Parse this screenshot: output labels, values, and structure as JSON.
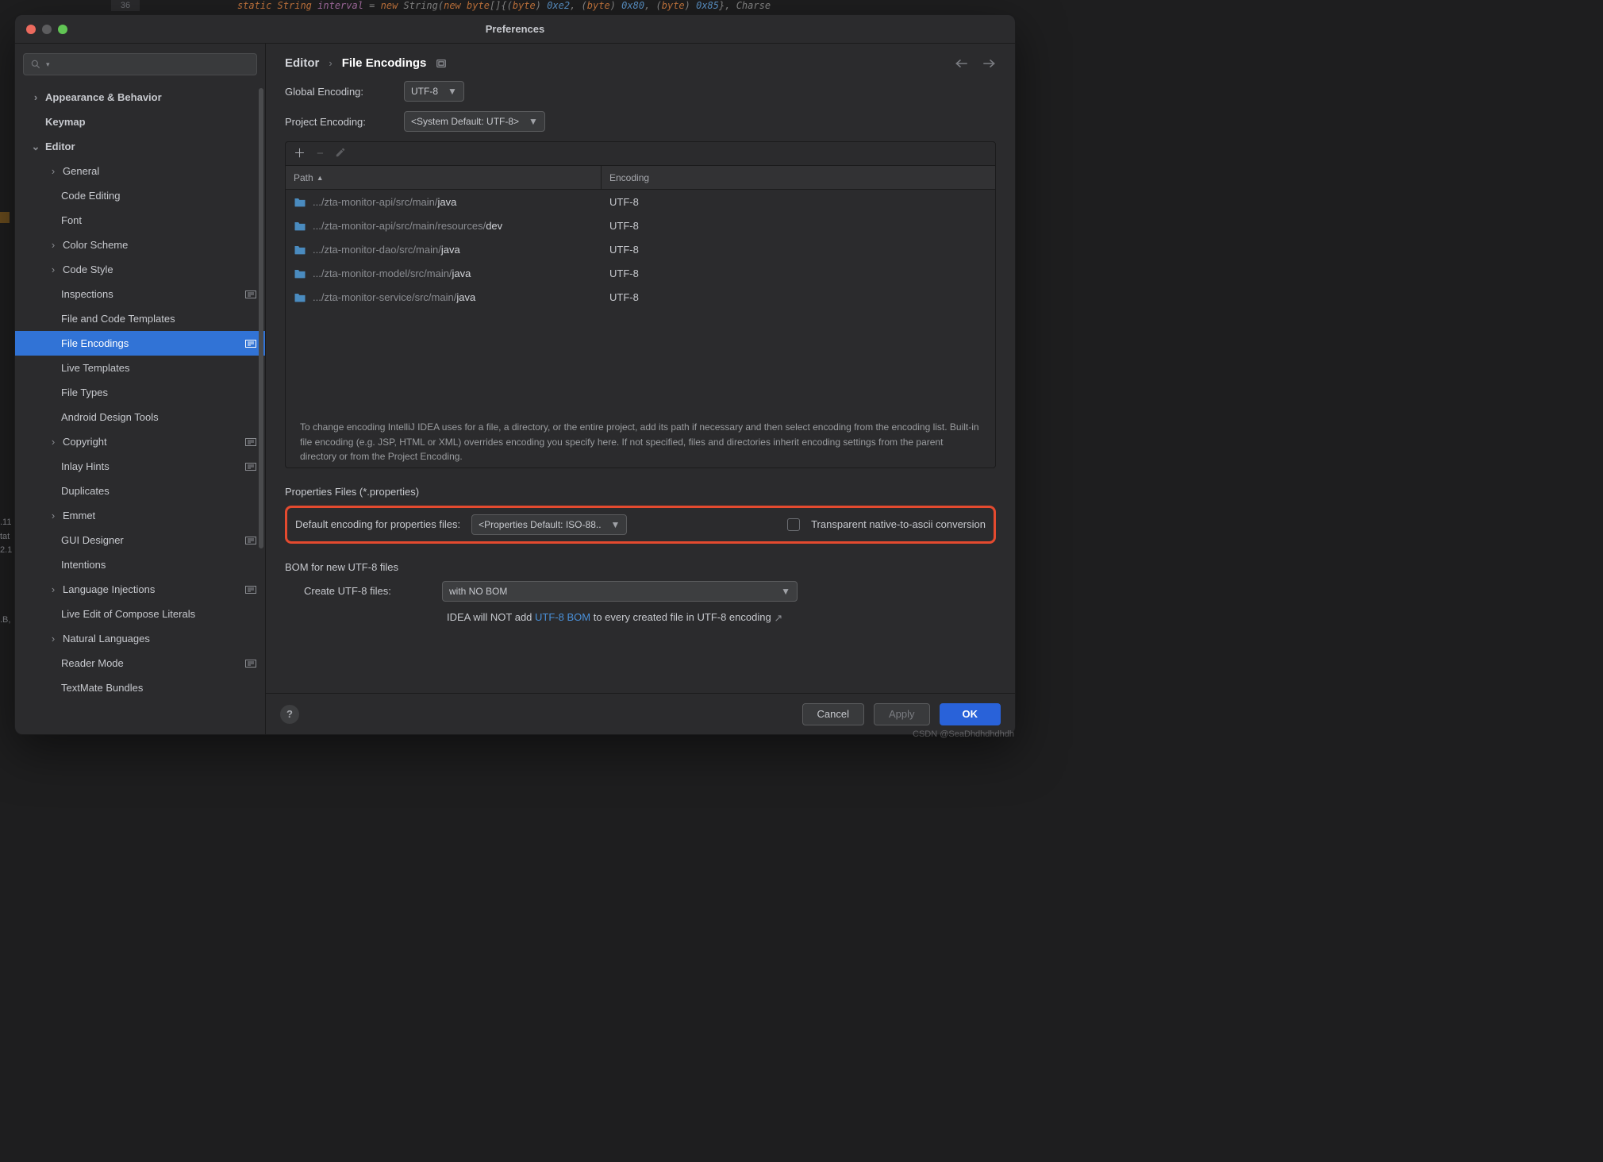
{
  "background": {
    "gutter": "36",
    "left_strip": ".11\ntat\n2.1\n\n\n\n\n.B,"
  },
  "window": {
    "title": "Preferences"
  },
  "breadcrumb": {
    "root": "Editor",
    "leaf": "File Encodings"
  },
  "sidebar": {
    "items": [
      {
        "label": "Appearance & Behavior",
        "level": 0,
        "chevron": "right",
        "bold": true
      },
      {
        "label": "Keymap",
        "level": 0,
        "bold": true
      },
      {
        "label": "Editor",
        "level": 0,
        "chevron": "down",
        "bold": true
      },
      {
        "label": "General",
        "level": 1,
        "chevron": "right"
      },
      {
        "label": "Code Editing",
        "level": 1
      },
      {
        "label": "Font",
        "level": 1
      },
      {
        "label": "Color Scheme",
        "level": 1,
        "chevron": "right"
      },
      {
        "label": "Code Style",
        "level": 1,
        "chevron": "right"
      },
      {
        "label": "Inspections",
        "level": 1,
        "badge": true
      },
      {
        "label": "File and Code Templates",
        "level": 1
      },
      {
        "label": "File Encodings",
        "level": 1,
        "selected": true,
        "badge": true
      },
      {
        "label": "Live Templates",
        "level": 1
      },
      {
        "label": "File Types",
        "level": 1
      },
      {
        "label": "Android Design Tools",
        "level": 1
      },
      {
        "label": "Copyright",
        "level": 1,
        "chevron": "right",
        "badge": true
      },
      {
        "label": "Inlay Hints",
        "level": 1,
        "badge": true
      },
      {
        "label": "Duplicates",
        "level": 1
      },
      {
        "label": "Emmet",
        "level": 1,
        "chevron": "right"
      },
      {
        "label": "GUI Designer",
        "level": 1,
        "badge": true
      },
      {
        "label": "Intentions",
        "level": 1
      },
      {
        "label": "Language Injections",
        "level": 1,
        "chevron": "right",
        "badge": true
      },
      {
        "label": "Live Edit of Compose Literals",
        "level": 1
      },
      {
        "label": "Natural Languages",
        "level": 1,
        "chevron": "right"
      },
      {
        "label": "Reader Mode",
        "level": 1,
        "badge": true
      },
      {
        "label": "TextMate Bundles",
        "level": 1
      }
    ]
  },
  "settings": {
    "global_label": "Global Encoding:",
    "global_value": "UTF-8",
    "project_label": "Project Encoding:",
    "project_value": "<System Default: UTF-8>"
  },
  "table": {
    "headers": {
      "path": "Path",
      "encoding": "Encoding"
    },
    "rows": [
      {
        "dim": ".../zta-monitor-api/src/main/",
        "bright": "java",
        "enc": "UTF-8"
      },
      {
        "dim": ".../zta-monitor-api/src/main/resources/",
        "bright": "dev",
        "enc": "UTF-8"
      },
      {
        "dim": ".../zta-monitor-dao/src/main/",
        "bright": "java",
        "enc": "UTF-8"
      },
      {
        "dim": ".../zta-monitor-model/src/main/",
        "bright": "java",
        "enc": "UTF-8"
      },
      {
        "dim": ".../zta-monitor-service/src/main/",
        "bright": "java",
        "enc": "UTF-8"
      }
    ]
  },
  "hint": "To change encoding IntelliJ IDEA uses for a file, a directory, or the entire project, add its path if necessary and then select encoding from the encoding list. Built-in file encoding (e.g. JSP, HTML or XML) overrides encoding you specify here. If not specified, files and directories inherit encoding settings from the parent directory or from the Project Encoding.",
  "properties": {
    "section": "Properties Files (*.properties)",
    "label": "Default encoding for properties files:",
    "value": "<Properties Default: ISO-88..",
    "checkbox_label": "Transparent native-to-ascii conversion"
  },
  "bom": {
    "section": "BOM for new UTF-8 files",
    "label": "Create UTF-8 files:",
    "value": "with NO BOM",
    "note_pre": "IDEA will NOT add ",
    "note_link": "UTF-8 BOM",
    "note_post": " to every created file in UTF-8 encoding"
  },
  "footer": {
    "cancel": "Cancel",
    "apply": "Apply",
    "ok": "OK"
  },
  "watermark": "CSDN @SeaDhdhdhdhdh"
}
